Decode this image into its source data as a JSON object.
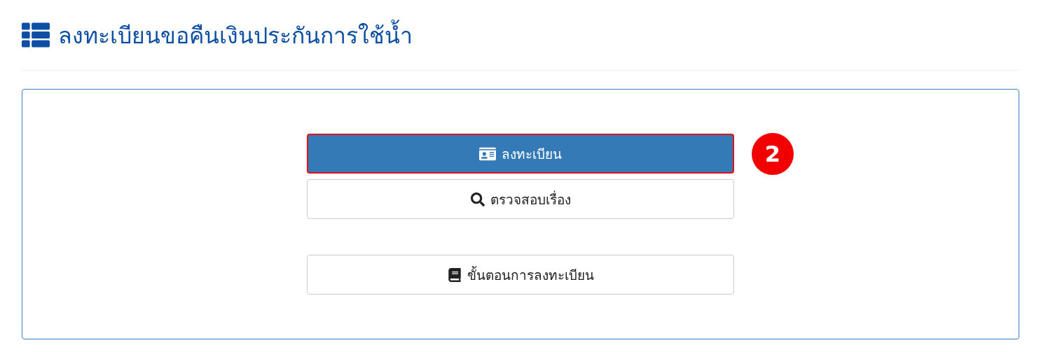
{
  "page_title": "ลงทะเบียนขอคืนเงินประกันการใช้น้ำ",
  "button_groups": [
    [
      {
        "label": "ลงทะเบียน",
        "kind": "primary",
        "highlighted": true,
        "badge": "2"
      },
      {
        "label": "ตรวจสอบเรื่อง",
        "kind": "default",
        "highlighted": false
      }
    ],
    [
      {
        "label": "ขั้นตอนการลงทะเบียน",
        "kind": "default",
        "highlighted": false
      }
    ]
  ]
}
